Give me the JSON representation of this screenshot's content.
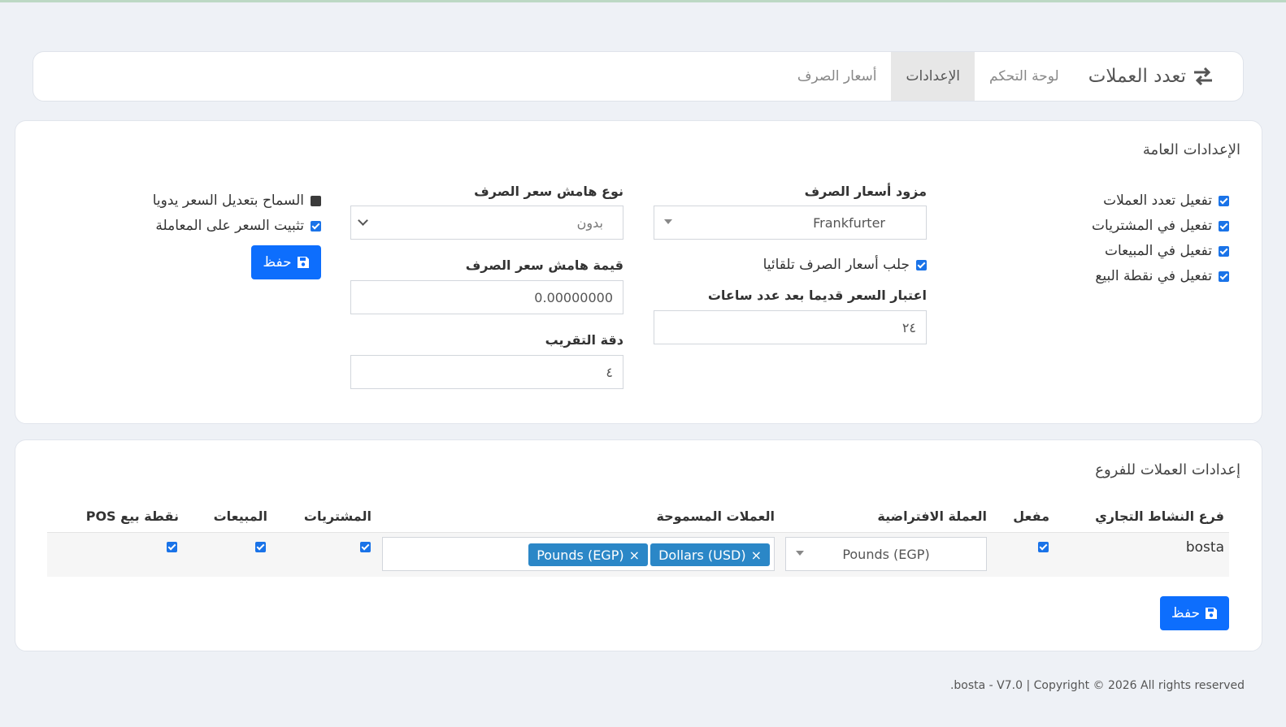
{
  "app": {
    "brand": "تعدد العملات",
    "brand_icon": "exchange-arrows-icon",
    "tabs": [
      "لوحة التحكم",
      "الإعدادات",
      "أسعار الصرف"
    ],
    "active_tab": "الإعدادات"
  },
  "general": {
    "title": "الإعدادات العامة",
    "enable_multicurrency": "تفعيل تعدد العملات",
    "enable_purchases": "تفعيل في المشتريات",
    "enable_sales": "تفعيل في المبيعات",
    "enable_pos": "تفعيل في نقطة البيع",
    "provider_label": "مزود أسعار الصرف",
    "provider_value": "Frankfurter",
    "auto_fetch": "جلب أسعار الصرف تلقائيا",
    "stale_label": "اعتبار السعر قديما بعد عدد ساعات",
    "stale_value": "٢٤",
    "margin_type_label": "نوع هامش سعر الصرف",
    "margin_type_value": "بدون",
    "margin_value_label": "قيمة هامش سعر الصرف",
    "margin_value": "0.00000000",
    "rounding_label": "دقة التقريب",
    "rounding_value": "٤",
    "allow_manual": "السماح بتعديل السعر يدويا",
    "lock_rate": "تثبيت السعر على المعاملة",
    "save_label": "حفظ"
  },
  "branches": {
    "title": "إعدادات العملات للفروع",
    "columns": {
      "branch": "فرع النشاط التجاري",
      "enabled": "مفعل",
      "default_currency": "العملة الافتراضية",
      "allowed_currencies": "العملات المسموحة",
      "purchases": "المشتريات",
      "sales": "المبيعات",
      "pos": "نقطة بيع POS"
    },
    "rows": [
      {
        "branch": "bosta",
        "default_currency": "Pounds (EGP)",
        "allowed": [
          "Dollars (USD)",
          "Pounds (EGP)"
        ],
        "tag_remove": "×"
      }
    ],
    "save_label": "حفظ"
  },
  "footer": ".bosta - V7.0 | Copyright © 2026 All rights reserved",
  "colors": {
    "primary": "#0d6efd",
    "tag": "#2b87c7",
    "checkbox": "#1a73e8"
  }
}
